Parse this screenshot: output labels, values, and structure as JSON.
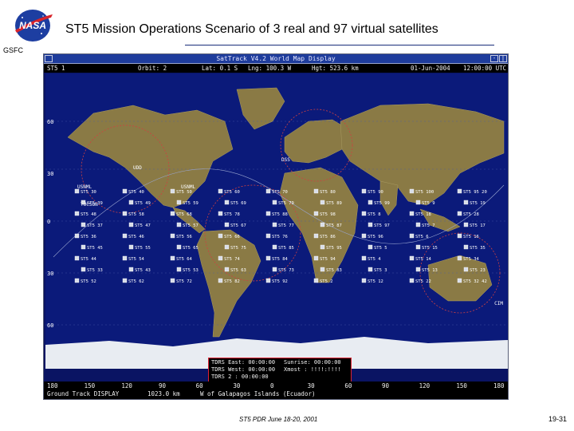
{
  "slide": {
    "logo_text": "NASA",
    "org_label": "GSFC",
    "title": "ST5 Mission Operations Scenario of 3 real and 97 virtual satellites",
    "footer_center": "ST5 PDR June 18-20, 2001",
    "page_number": "19-31"
  },
  "window": {
    "title": "SatTrack V4.2  World Map Display",
    "controls": [
      "-",
      "|"
    ],
    "status": {
      "sat": "ST5 1",
      "orbit": "Orbit: 2",
      "lat": "Lat: 0.1 S",
      "lng": "Lng: 100.3 W",
      "hgt": "Hgt: 523.6 km",
      "date": "01-Jun-2004",
      "time": "12:00:00 UTC"
    }
  },
  "map": {
    "lat_labels": [
      "60",
      "30",
      "0",
      "30",
      "60"
    ],
    "lon_labels": [
      "180",
      "150",
      "120",
      "90",
      "60",
      "30",
      "0",
      "30",
      "60",
      "90",
      "120",
      "150",
      "180"
    ],
    "place_labels": [
      "UDD",
      "USNML",
      "TUCSON",
      "USNML",
      "DSS",
      "CIM"
    ],
    "rows": [
      [
        "ST5 30",
        "ST5 40",
        "ST5 50",
        "ST5 60",
        "ST5 70",
        "ST5 80",
        "ST5 90",
        "ST5 100",
        "ST5 95 20"
      ],
      [
        "ST5 39",
        "ST5 49",
        "ST5 59",
        "ST5 69",
        "ST5 79",
        "ST5 89",
        "ST5 99",
        "ST5 9",
        "ST5 19"
      ],
      [
        "ST5 48",
        "ST5 58",
        "ST5 68",
        "ST5 78",
        "ST5 88",
        "ST5 98",
        "ST5 8",
        "ST5 18",
        "ST5 28"
      ],
      [
        "ST5 37",
        "ST5 47",
        "ST5 57",
        "ST5 67",
        "ST5 77",
        "ST5 87",
        "ST5 97",
        "ST5 7",
        "ST5 17"
      ],
      [
        "ST5 36",
        "ST5 46",
        "ST5 56",
        "ST5 66",
        "ST5 76",
        "ST5 86",
        "ST5 96",
        "ST5 6",
        "ST5 16"
      ],
      [
        "ST5 45",
        "ST5 55",
        "ST5 65",
        "ST5 75",
        "ST5 85",
        "ST5 95",
        "ST5 5",
        "ST5 15",
        "ST5 35"
      ],
      [
        "ST5 44",
        "ST5 54",
        "ST5 64",
        "ST5 74",
        "ST5 84",
        "ST5 94",
        "ST5 4",
        "ST5 14",
        "ST5 34"
      ],
      [
        "ST5 33",
        "ST5 43",
        "ST5 53",
        "ST5 63",
        "ST5 73",
        "ST5 83",
        "ST5 3",
        "ST5 13",
        "ST5 23"
      ],
      [
        "ST5 52",
        "ST5 62",
        "ST5 72",
        "ST5 82",
        "ST5 92",
        "ST5 2",
        "ST5 12",
        "ST5 22",
        "ST5 32 42"
      ]
    ],
    "colors": {
      "ocean": "#0b1a7a",
      "land": "#8a7a45",
      "ice": "#e8ecf2",
      "sat_box": "#d8dde8",
      "orbit": "#d04040"
    }
  },
  "tdrs": {
    "east": "TDRS East: 00:00:00",
    "west": "TDRS West: 00:00:00",
    "tdrs2": "TDRS 2   : 00:00:00",
    "sunrise": "Sunrise: 00:00:00",
    "xmost": "Xmost : !!!!:!!!!"
  },
  "bottom": {
    "ticks": [
      "180",
      "150",
      "120",
      "90",
      "60",
      "30",
      "0",
      "30",
      "60",
      "90",
      "120",
      "150",
      "180"
    ],
    "mode": "Ground Track DISPLAY",
    "distance": "1023.0 km",
    "location": "W of Galapagos Islands (Ecuador)"
  }
}
